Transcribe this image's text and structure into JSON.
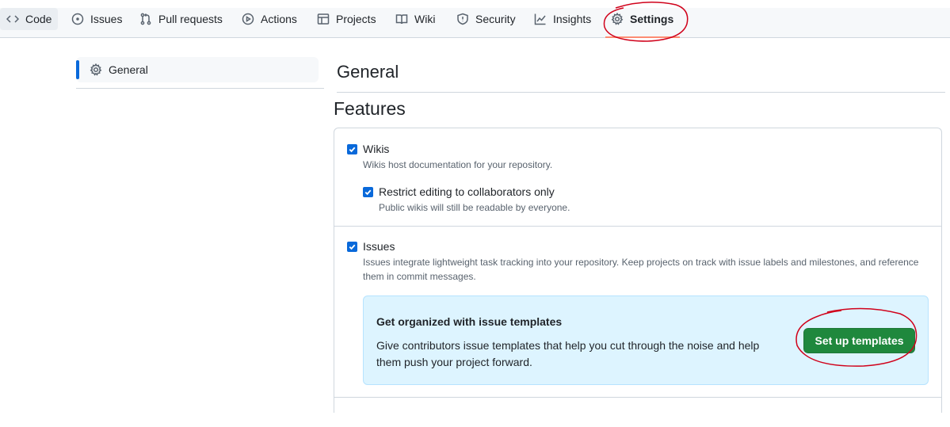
{
  "nav": {
    "tabs": [
      {
        "label": "Code",
        "icon": "code-icon"
      },
      {
        "label": "Issues",
        "icon": "issue-opened-icon"
      },
      {
        "label": "Pull requests",
        "icon": "git-pull-request-icon"
      },
      {
        "label": "Actions",
        "icon": "play-icon"
      },
      {
        "label": "Projects",
        "icon": "table-icon"
      },
      {
        "label": "Wiki",
        "icon": "book-icon"
      },
      {
        "label": "Security",
        "icon": "shield-icon"
      },
      {
        "label": "Insights",
        "icon": "graph-icon"
      },
      {
        "label": "Settings",
        "icon": "gear-icon"
      }
    ],
    "selected": "Settings"
  },
  "sidebar": {
    "items": [
      {
        "label": "General",
        "icon": "gear-icon",
        "active": true
      }
    ]
  },
  "main": {
    "title": "General",
    "features_title": "Features",
    "wikis": {
      "label": "Wikis",
      "checked": true,
      "description": "Wikis host documentation for your repository.",
      "restrict": {
        "label": "Restrict editing to collaborators only",
        "checked": true,
        "description": "Public wikis will still be readable by everyone."
      }
    },
    "issues": {
      "label": "Issues",
      "checked": true,
      "description_line1": "Issues integrate lightweight task tracking into your repository. Keep projects on track with issue labels and milestones, and reference",
      "description_line2": "them in commit messages."
    },
    "templates": {
      "title": "Get organized with issue templates",
      "description": "Give contributors issue templates that help you cut through the noise and help them push your project forward.",
      "button_label": "Set up templates"
    }
  },
  "colors": {
    "accent": "#0969da",
    "primary_button": "#1f883d",
    "annotation": "#d0021b",
    "tab_underline": "#fd8c73",
    "callout_bg": "#ddf4ff"
  }
}
